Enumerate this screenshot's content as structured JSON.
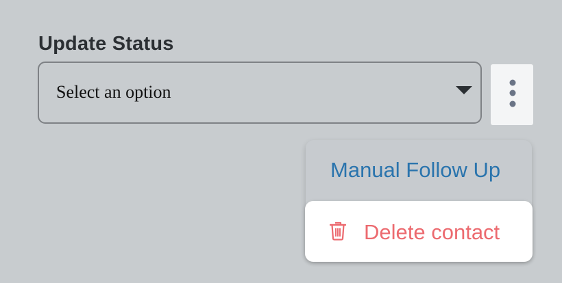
{
  "form": {
    "label": "Update Status",
    "select": {
      "value": "Select an option"
    }
  },
  "more_button": {
    "icon": "more-vertical-icon"
  },
  "menu": {
    "items": [
      {
        "label": "Manual Follow Up",
        "icon": null,
        "color": "#2a74ad"
      },
      {
        "label": "Delete contact",
        "icon": "trash-icon",
        "color": "#ec6a6f"
      }
    ]
  },
  "colors": {
    "background": "#c8cccf",
    "link_blue": "#2a74ad",
    "danger_red": "#ec6a6f"
  }
}
